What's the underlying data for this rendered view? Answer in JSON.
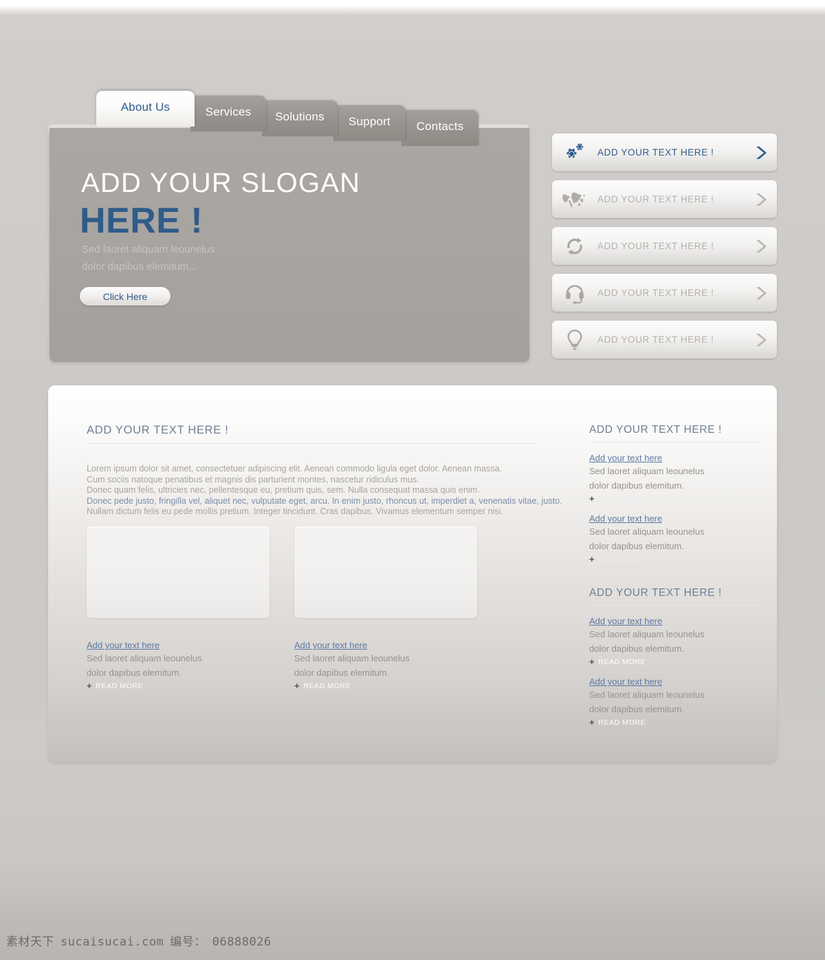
{
  "colors": {
    "accent_blue": "#2f5b8a",
    "link_blue": "#5c7ba3",
    "heading_blue_gray": "#6e7f93",
    "hero_panel": "#a8a4a0",
    "tab_inactive": "#97928d",
    "body_gray": "#96938f",
    "page_background": "#cfccc9"
  },
  "nav": {
    "tabs": [
      {
        "label": "About Us",
        "active": true
      },
      {
        "label": "Services",
        "active": false
      },
      {
        "label": "Solutions",
        "active": false
      },
      {
        "label": "Support",
        "active": false
      },
      {
        "label": "Contacts",
        "active": false
      }
    ]
  },
  "hero": {
    "slogan": "ADD YOUR SLOGAN",
    "highlight": "HERE !",
    "sub_line_1": "Sed laoret aliquam leounelus",
    "sub_line_2": "dolor dapibus elemitum...",
    "cta_label": "Click Here"
  },
  "features": [
    {
      "label": "ADD YOUR TEXT HERE !",
      "icon": "gears-icon",
      "active": true
    },
    {
      "label": "ADD YOUR TEXT HERE !",
      "icon": "world-map-icon",
      "active": false
    },
    {
      "label": "ADD YOUR TEXT HERE !",
      "icon": "refresh-icon",
      "active": false
    },
    {
      "label": "ADD YOUR TEXT HERE !",
      "icon": "headset-icon",
      "active": false
    },
    {
      "label": "ADD YOUR TEXT HERE !",
      "icon": "lightbulb-icon",
      "active": false
    }
  ],
  "main": {
    "section_title": "ADD YOUR TEXT HERE !",
    "paragraph_lines": [
      {
        "text": "Lorem ipsum dolor sit amet, consectetuer adipiscing elit. Aenean commodo ligula eget dolor. Aenean massa.",
        "highlighted": false
      },
      {
        "text": "Cum sociis natoque penatibus et magnis dis parturient montes, nascetur ridiculus mus.",
        "highlighted": false
      },
      {
        "text": "Donec quam felis, ultricies nec, pellentesque eu, pretium quis, sem. Nulla consequat massa quis enim.",
        "highlighted": false
      },
      {
        "text": "Donec pede justo, fringilla vel, aliquet nec, vulputate eget, arcu. In enim justo, rhoncus ut, imperdiet a, venenatis vitae, justo.",
        "highlighted": true
      },
      {
        "text": "Nullam dictum felis eu pede mollis pretium. Integer tincidunt. Cras dapibus. Vivamus elementum semper nisi.",
        "highlighted": false
      }
    ],
    "cards": [
      {
        "link": "Add your text here",
        "line_1": "Sed laoret aliquam leounelus",
        "line_2": "dolor dapibus elemitum.",
        "read_more": "READ MORE"
      },
      {
        "link": "Add your text here",
        "line_1": "Sed laoret aliquam leounelus",
        "line_2": "dolor dapibus elemitum.",
        "read_more": "READ MORE"
      }
    ]
  },
  "sidebar": {
    "groups": [
      {
        "title": "ADD YOUR TEXT HERE !",
        "items": [
          {
            "link": "Add your text here",
            "line_1": "Sed laoret aliquam leounelus",
            "line_2": "dolor dapibus elemitum.",
            "read_more": "READ MORE"
          },
          {
            "link": "Add your text here",
            "line_1": "Sed laoret aliquam leounelus",
            "line_2": "dolor dapibus elemitum.",
            "read_more": "READ MORE"
          }
        ]
      },
      {
        "title": "ADD YOUR TEXT HERE !",
        "items": [
          {
            "link": "Add your text here",
            "line_1": "Sed laoret aliquam leounelus",
            "line_2": "dolor dapibus elemitum.",
            "read_more": "READ MORE"
          },
          {
            "link": "Add your text here",
            "line_1": "Sed laoret aliquam leounelus",
            "line_2": "dolor dapibus elemitum.",
            "read_more": "READ MORE"
          }
        ]
      }
    ]
  },
  "watermark": {
    "brand": "素材天下",
    "site": "sucaisucai.com",
    "id_label": "编号：",
    "id_value": "06888026"
  }
}
